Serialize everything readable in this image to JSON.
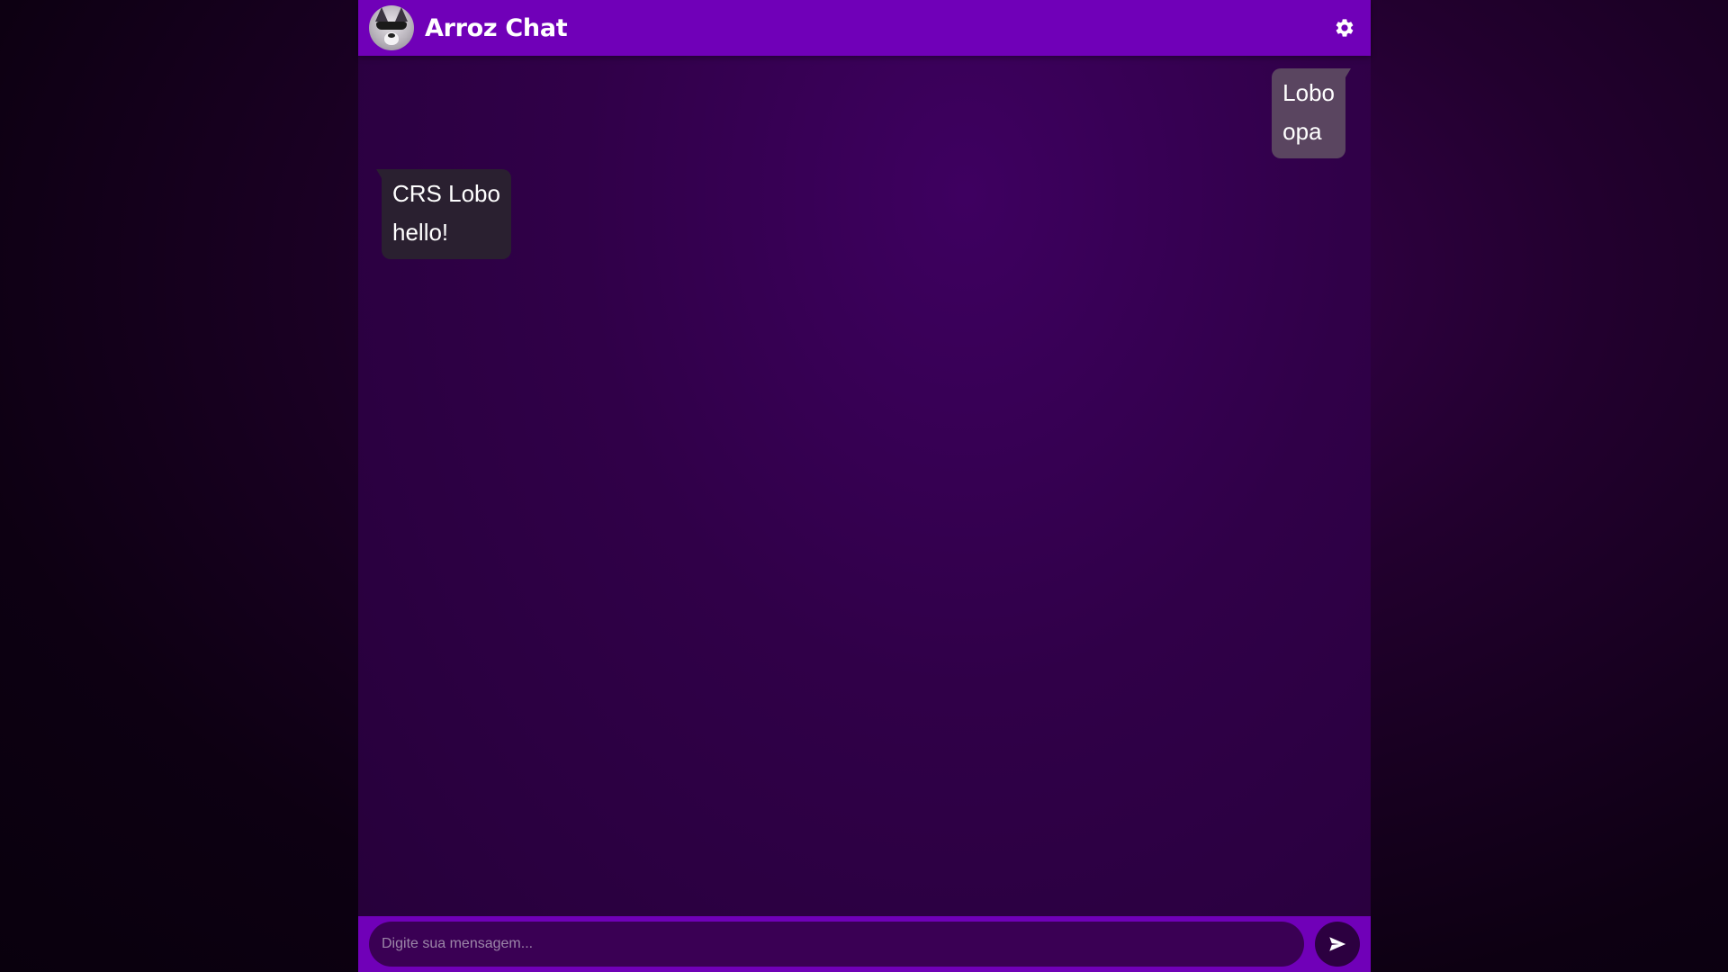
{
  "header": {
    "title": "Arroz Chat",
    "avatar_icon": "husky-sunglasses-avatar",
    "settings_icon": "gear-icon"
  },
  "messages": [
    {
      "side": "right",
      "sender": "Lobo",
      "text": "opa"
    },
    {
      "side": "left",
      "sender": "CRS Lobo",
      "text": "hello!"
    }
  ],
  "composer": {
    "placeholder": "Digite sua mensagem...",
    "value": "",
    "send_icon": "send-icon"
  },
  "colors": {
    "header": "#7000b8",
    "footer": "#7000b8",
    "own_bubble": "#5a4560",
    "other_bubble": "#2a2030",
    "input_bg": "#3a0054",
    "send_button": "#2c0040"
  }
}
